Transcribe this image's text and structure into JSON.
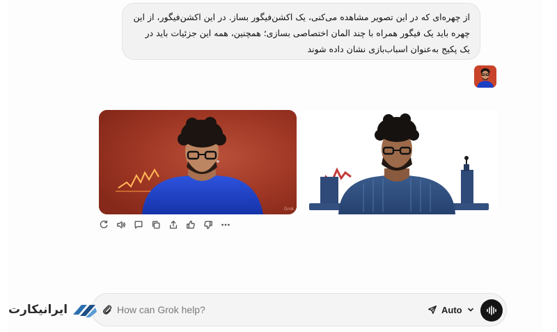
{
  "conversation": {
    "user_message": "از چهره‌ای که در این تصویر مشاهده می‌کنی، یک اکشن‌فیگور بساز. در این اکشن‌فیگور، از این چهره باید یک فیگور همراه با چند المان اختصاصی بسازی؛ همچنین، همه این جزئیات باید در یک پکیج به‌عنوان اسباب‌بازی نشان داده شوند",
    "user_avatar_icon": "user-photo-avatar",
    "images": [
      {
        "description_icon": "generated-portrait-blue-sweater-red-background"
      },
      {
        "description_icon": "generated-action-figure-knit-sweater"
      }
    ],
    "actions": [
      {
        "icon": "regenerate-icon"
      },
      {
        "icon": "read-aloud-icon"
      },
      {
        "icon": "comment-icon"
      },
      {
        "icon": "copy-icon"
      },
      {
        "icon": "share-icon"
      },
      {
        "icon": "thumbs-up-icon"
      },
      {
        "icon": "thumbs-down-icon"
      },
      {
        "icon": "more-icon"
      }
    ]
  },
  "composer": {
    "placeholder": "How can Grok help?",
    "mode": "Auto"
  },
  "watermark": {
    "text": "ایرانیکارت"
  },
  "colors": {
    "accent_dark": "#141414",
    "bubble_bg": "#f2f2f2",
    "image_bg_red": "#9c3322",
    "sweater_blue": "#1d3fc4"
  }
}
